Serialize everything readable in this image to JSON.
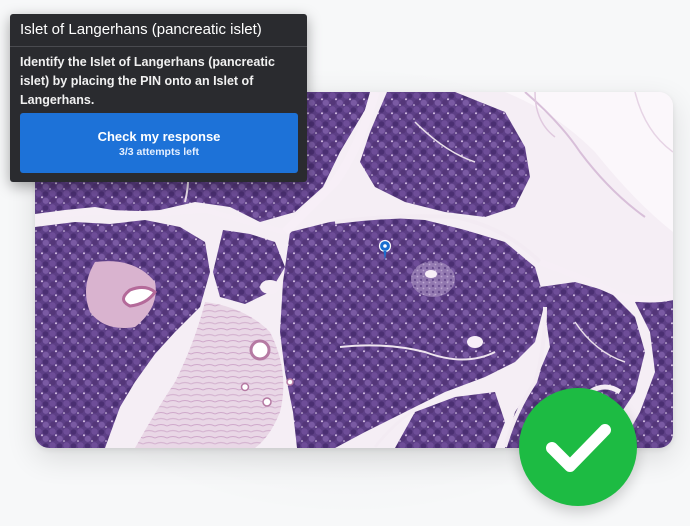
{
  "prompt_panel": {
    "title": "Islet of Langerhans (pancreatic islet)",
    "instruction": "Identify the Islet of Langerhans (pancreatic islet) by placing the PIN onto an Islet of Langerhans.",
    "check_button_label": "Check my response",
    "attempts_text": "3/3 attempts left"
  },
  "image": {
    "subject": "pancreatic tissue histology slide"
  },
  "pin": {
    "icon": "map-pin-icon",
    "color": "#1a6fd0"
  },
  "result": {
    "icon": "checkmark-icon",
    "status": "correct",
    "color": "#1dbb43"
  }
}
